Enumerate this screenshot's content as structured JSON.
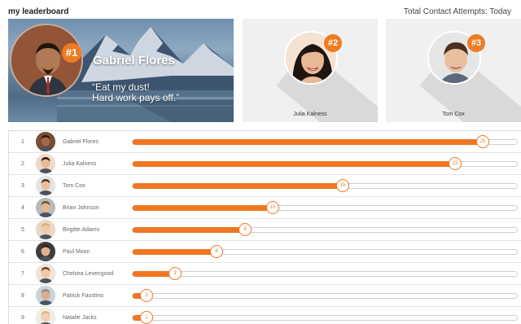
{
  "header": {
    "title": "my leaderboard",
    "metric_label": "Total Contact Attempts: Today"
  },
  "podium": {
    "first": {
      "rank": "#1",
      "name": "Gabriel Flores",
      "quote": "“Eat my dust!\nHard work pays off.”"
    },
    "second": {
      "rank": "#2",
      "name": "Julia Kalness"
    },
    "third": {
      "rank": "#3",
      "name": "Tom Cox"
    }
  },
  "max_score": 25,
  "rows": [
    {
      "rank": "1",
      "name": "Gabriel Flores",
      "score": 25,
      "skin": "#a06a48",
      "hair": "#2a1a10",
      "bg": "#7a4c34"
    },
    {
      "rank": "2",
      "name": "Julia Kalness",
      "score": 23,
      "skin": "#e8b995",
      "hair": "#1e1410",
      "bg": "#f2d9c6"
    },
    {
      "rank": "3",
      "name": "Tom Cox",
      "score": 15,
      "skin": "#e8c0a0",
      "hair": "#4a3020",
      "bg": "#e4e4e4"
    },
    {
      "rank": "4",
      "name": "Brian Johnson",
      "score": 10,
      "skin": "#e3b792",
      "hair": "#6a5030",
      "bg": "#b9b9b9"
    },
    {
      "rank": "5",
      "name": "Brigitte Adams",
      "score": 8,
      "skin": "#efc9a8",
      "hair": "#d9b070",
      "bg": "#e8d8c8"
    },
    {
      "rank": "6",
      "name": "Paul Moon",
      "score": 6,
      "skin": "#e0b38e",
      "hair": "#2a2218",
      "bg": "#3c3c3c"
    },
    {
      "rank": "7",
      "name": "Chelsea Levengood",
      "score": 3,
      "skin": "#f0c8a8",
      "hair": "#6a3c22",
      "bg": "#efe4da"
    },
    {
      "rank": "8",
      "name": "Patrick Faustino",
      "score": 1,
      "skin": "#d9ad8c",
      "hair": "#8a8a8a",
      "bg": "#c8d4dc"
    },
    {
      "rank": "9",
      "name": "Natalie Jacks",
      "score": 1,
      "skin": "#f0cfb4",
      "hair": "#d8b880",
      "bg": "#f0ece6"
    }
  ],
  "colors": {
    "accent": "#ef7622",
    "card_bg": "#f0f0f0"
  }
}
